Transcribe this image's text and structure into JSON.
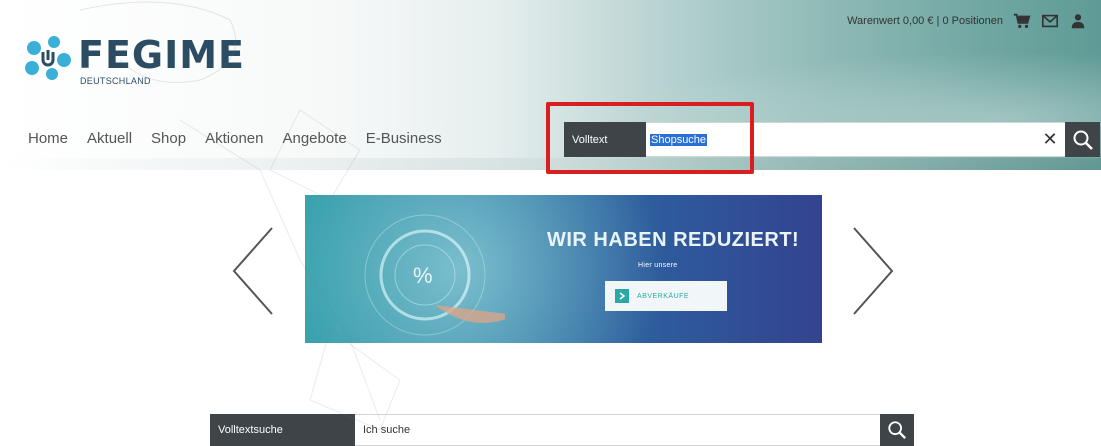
{
  "header": {
    "cart_summary": "Warenwert 0,00 € | 0 Positionen",
    "icons": [
      "cart-icon",
      "mail-icon",
      "user-icon"
    ]
  },
  "logo": {
    "brand": "FEGIME",
    "subtitle": "DEUTSCHLAND"
  },
  "nav": {
    "items": [
      "Home",
      "Aktuell",
      "Shop",
      "Aktionen",
      "Angebote",
      "E-Business"
    ]
  },
  "search": {
    "label": "Volltext",
    "value": "Shopsuche",
    "clear": "✕"
  },
  "banner": {
    "headline": "WIR HABEN REDUZIERT!",
    "subline": "Hier unsere",
    "button": "ABVERKÄUFE"
  },
  "bottom_search": {
    "label": "Volltextsuche",
    "placeholder": "Ich suche"
  },
  "colors": {
    "brand": "#2b4c63",
    "logo_mark": "#3ab0d8",
    "highlight": "#d81e1e",
    "dark_button": "#3e4448"
  }
}
